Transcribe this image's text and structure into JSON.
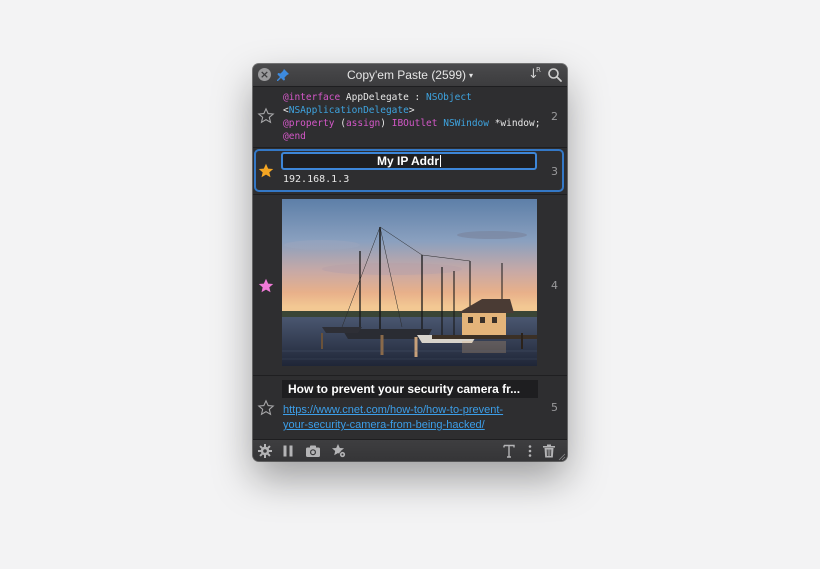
{
  "window": {
    "title": "Copy'em Paste (2599)",
    "title_caret": "▾",
    "sort_glyph": "↓",
    "sort_super": "R"
  },
  "clips": [
    {
      "index": "2",
      "starred": false,
      "type": "code",
      "lines": [
        [
          {
            "t": "@interface",
            "c": "kw"
          },
          {
            "t": " AppDelegate : ",
            "c": ""
          },
          {
            "t": "NSObject",
            "c": "ty"
          }
        ],
        [
          {
            "t": "<",
            "c": ""
          },
          {
            "t": "NSApplicationDelegate",
            "c": "ty"
          },
          {
            "t": ">",
            "c": ""
          }
        ],
        [
          {
            "t": "@property",
            "c": "kw"
          },
          {
            "t": " (",
            "c": ""
          },
          {
            "t": "assign",
            "c": "kw"
          },
          {
            "t": ") ",
            "c": ""
          },
          {
            "t": "IBOutlet",
            "c": "kw"
          },
          {
            "t": " ",
            "c": ""
          },
          {
            "t": "NSWindow",
            "c": "ty"
          },
          {
            "t": " *window;",
            "c": ""
          }
        ],
        [
          {
            "t": "@end",
            "c": "kw"
          }
        ]
      ]
    },
    {
      "index": "3",
      "starred": true,
      "star_color": "#f5a623",
      "type": "text",
      "title": "My IP Addr",
      "content": "192.168.1.3"
    },
    {
      "index": "4",
      "starred": true,
      "star_color": "#f07ad8",
      "type": "image"
    },
    {
      "index": "5",
      "starred": false,
      "type": "link",
      "title": "How to prevent your security camera fr...",
      "url_line1": "https://www.cnet.com/how-to/how-to-prevent-",
      "url_line2": "your-security-camera-from-being-hacked/"
    }
  ],
  "toolbar": {
    "icons": [
      "gear-icon",
      "pause-icon",
      "camera-icon",
      "star-gear-icon",
      "text-format-icon",
      "more-icon",
      "trash-icon"
    ]
  },
  "colors": {
    "accent": "#3478c6",
    "link": "#3c9ee8",
    "keyword": "#d458c8",
    "type": "#3ea4e0"
  }
}
